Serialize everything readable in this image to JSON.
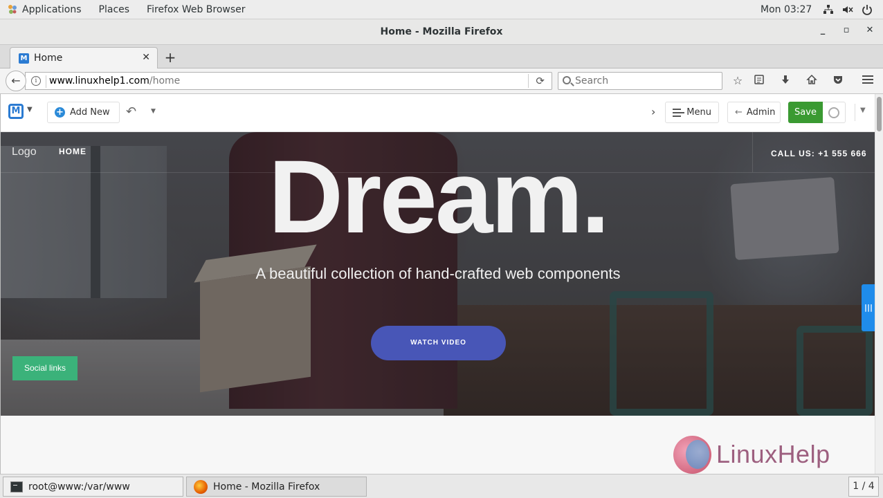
{
  "topbar": {
    "applications_label": "Applications",
    "places_label": "Places",
    "active_app_label": "Firefox Web Browser",
    "clock": "Mon 03:27"
  },
  "window": {
    "title": "Home - Mozilla Firefox"
  },
  "browser": {
    "tab_title": "Home",
    "url_host": "www.linuxhelp1.com",
    "url_path": "/home",
    "search_placeholder": "Search"
  },
  "cms_toolbar": {
    "add_new_label": "Add New",
    "menu_label": "Menu",
    "admin_label": "Admin",
    "save_label": "Save",
    "colors": {
      "save": "#3a9a32",
      "accent": "#2b7bd2"
    }
  },
  "hero": {
    "logo_text": "Logo",
    "nav_home": "HOME",
    "call_us": "CALL US: +1 555 666",
    "headline": "Dream.",
    "subline": "A beautiful collection of hand-crafted web components",
    "watch_video_label": "WATCH VIDEO",
    "social_links_label": "Social links",
    "side_tab_label": "|||",
    "colors": {
      "watch_button": "#4856b7",
      "social_button": "#3bb27a",
      "side_tab": "#1f8ceb"
    }
  },
  "watermark": {
    "text": "LinuxHelp"
  },
  "taskbar": {
    "terminal_task": "root@www:/var/www",
    "firefox_task": "Home - Mozilla Firefox",
    "workspace": "1 / 4"
  }
}
